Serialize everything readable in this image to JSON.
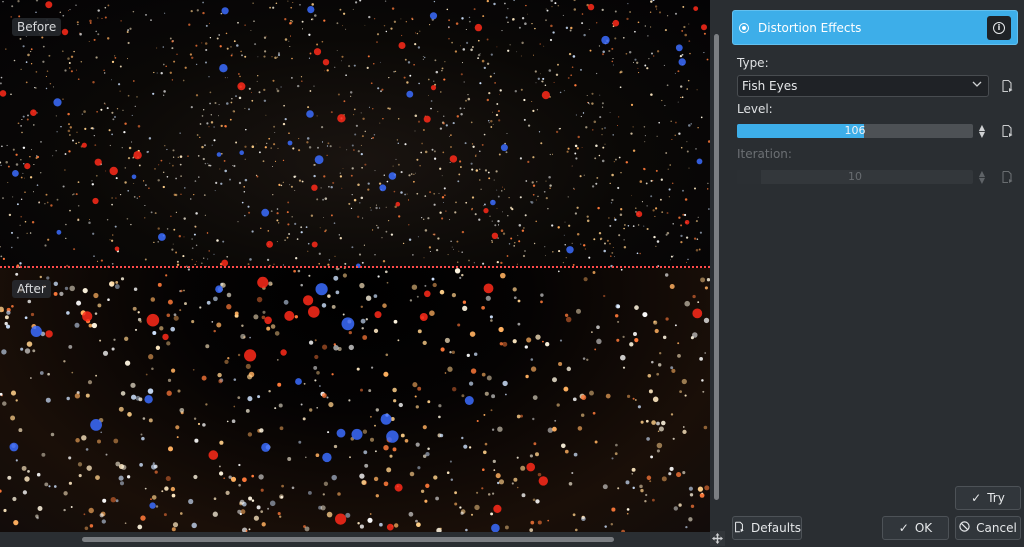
{
  "preview": {
    "before_label": "Before",
    "after_label": "After"
  },
  "panel": {
    "effect_title": "Distortion Effects",
    "type": {
      "label": "Type:",
      "selected": "Fish Eyes"
    },
    "level": {
      "label": "Level:",
      "value": "106",
      "fill_fraction": 0.54
    },
    "iteration": {
      "label": "Iteration:",
      "value": "10",
      "fill_fraction": 0.1,
      "enabled": false
    }
  },
  "buttons": {
    "try": "Try",
    "defaults": "Defaults",
    "ok": "OK",
    "cancel": "Cancel"
  },
  "icons": {
    "info": "info-icon",
    "reset": "reset-to-default-icon",
    "pan": "pan-move-icon",
    "check": "check-icon",
    "cancel": "cancel-circle-icon",
    "dropdown": "chevron-down-icon"
  },
  "colors": {
    "accent": "#3daee9",
    "background": "#2a2e32",
    "split_line": "#ff4a4a"
  }
}
